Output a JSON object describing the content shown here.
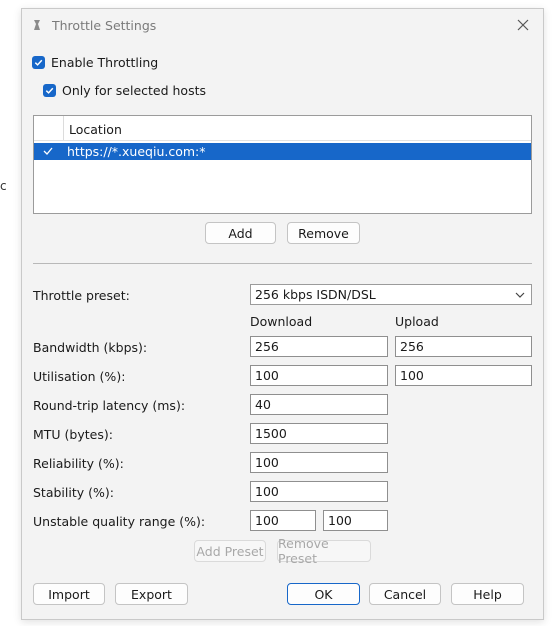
{
  "window": {
    "title": "Throttle Settings"
  },
  "hosts": {
    "enable_throttling": {
      "label": "Enable Throttling",
      "checked": true
    },
    "only_selected_hosts": {
      "label": "Only for selected hosts",
      "checked": true
    },
    "table": {
      "header": "Location",
      "rows": [
        {
          "url": "https://*.xueqiu.com:*",
          "checked": true,
          "selected": true
        }
      ]
    },
    "add_label": "Add",
    "remove_label": "Remove"
  },
  "settings": {
    "preset_label": "Throttle preset:",
    "preset_value": "256 kbps ISDN/DSL",
    "download_header": "Download",
    "upload_header": "Upload",
    "bandwidth": {
      "label": "Bandwidth (kbps):",
      "download": "256",
      "upload": "256"
    },
    "utilisation": {
      "label": "Utilisation (%):",
      "download": "100",
      "upload": "100"
    },
    "latency": {
      "label": "Round-trip latency (ms):",
      "value": "40"
    },
    "mtu": {
      "label": "MTU (bytes):",
      "value": "1500"
    },
    "reliability": {
      "label": "Reliability (%):",
      "value": "100"
    },
    "stability": {
      "label": "Stability (%):",
      "value": "100"
    },
    "unstable_range": {
      "label": "Unstable quality range (%):",
      "min": "100",
      "max": "100"
    },
    "add_preset_label": "Add Preset",
    "remove_preset_label": "Remove Preset"
  },
  "footer": {
    "import_label": "Import",
    "export_label": "Export",
    "ok_label": "OK",
    "cancel_label": "Cancel",
    "help_label": "Help"
  },
  "colors": {
    "accent": "#1767c9",
    "window_bg": "#f3f3f3"
  }
}
